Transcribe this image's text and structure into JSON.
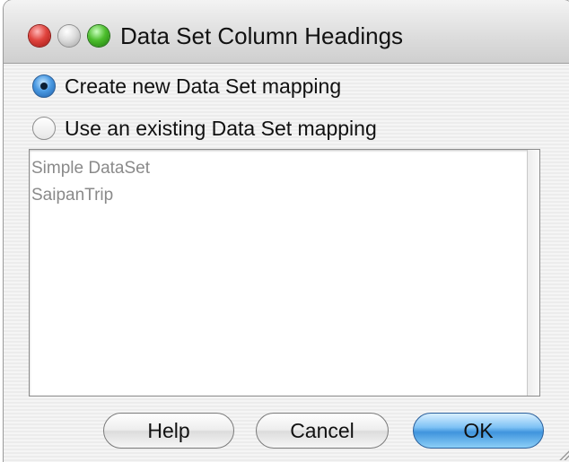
{
  "window": {
    "title": "Data Set Column Headings"
  },
  "options": [
    {
      "label": "Create new Data Set mapping",
      "checked": true
    },
    {
      "label": "Use an existing Data Set mapping",
      "checked": false
    }
  ],
  "list": {
    "items": [
      "Simple DataSet",
      "SaipanTrip"
    ]
  },
  "buttons": {
    "help": "Help",
    "cancel": "Cancel",
    "ok": "OK"
  },
  "colors": {
    "default_button": "#3f94dd",
    "close_button": "#e0443e",
    "zoom_button": "#4dbe2d"
  }
}
